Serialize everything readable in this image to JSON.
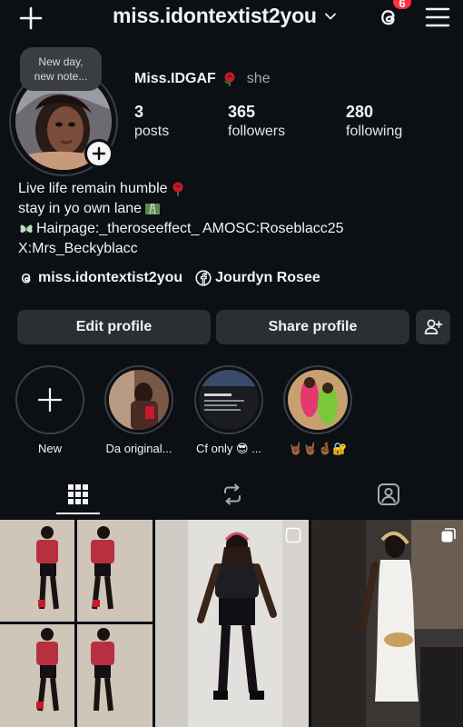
{
  "header": {
    "username": "miss.idontextist2you",
    "notif_count": "6",
    "plus_icon": "plus-icon",
    "threads_icon": "threads-icon",
    "menu_icon": "hamburger-menu-icon"
  },
  "profile": {
    "note": "New day,\nnew note...",
    "display_name": "Miss.IDGAF",
    "pronoun": "she",
    "stats": [
      {
        "value": "3",
        "label": "posts"
      },
      {
        "value": "365",
        "label": "followers"
      },
      {
        "value": "280",
        "label": "following"
      }
    ],
    "bio": {
      "line1": "Live life remain humble",
      "line2": "stay in yo own lane",
      "line3": "Hairpage:_theroseeffect_ AMOSC:Roseblacc25",
      "line4": "X:Mrs_Beckyblacc"
    },
    "links": [
      {
        "icon": "threads-icon",
        "text": "miss.idontextist2you"
      },
      {
        "icon": "facebook-icon",
        "text": "Jourdyn Rosee"
      }
    ]
  },
  "buttons": {
    "edit": "Edit profile",
    "share": "Share profile",
    "add_person_icon": "add-person-icon"
  },
  "highlights": [
    {
      "label": "New"
    },
    {
      "label": "Da original..."
    },
    {
      "label": "Cf only 😎 ..."
    },
    {
      "label": "🤘🏾🤘🏾🤞🏾🔐"
    }
  ],
  "tabs": [
    {
      "icon": "grid-icon",
      "active": true
    },
    {
      "icon": "reposts-icon",
      "active": false
    },
    {
      "icon": "tagged-icon",
      "active": false
    }
  ],
  "colors": {
    "background": "#0c0f14",
    "button": "#2b2e33",
    "badge": "#ff3040",
    "text": "#f2f3f5",
    "muted": "#a8abb1"
  }
}
